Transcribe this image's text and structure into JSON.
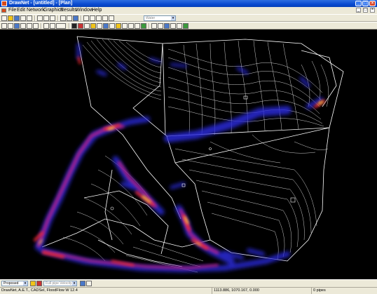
{
  "window": {
    "title": "DrawNet - [untitled] - [Plan]"
  },
  "menu": [
    "File",
    "Edit",
    "Network",
    "Graphics",
    "Results",
    "Window",
    "Help"
  ],
  "toolbar": {
    "layer_combo": "Water"
  },
  "bottom": {
    "scenario": "Proposed",
    "result_combo": "Full pipe Velocity"
  },
  "status": {
    "program": "DrawNet, A.E.T., CADSel, FloodFlow W 12.4",
    "coords": "1113.886, 1070.167, 0.000",
    "selection": "0 pipes"
  }
}
